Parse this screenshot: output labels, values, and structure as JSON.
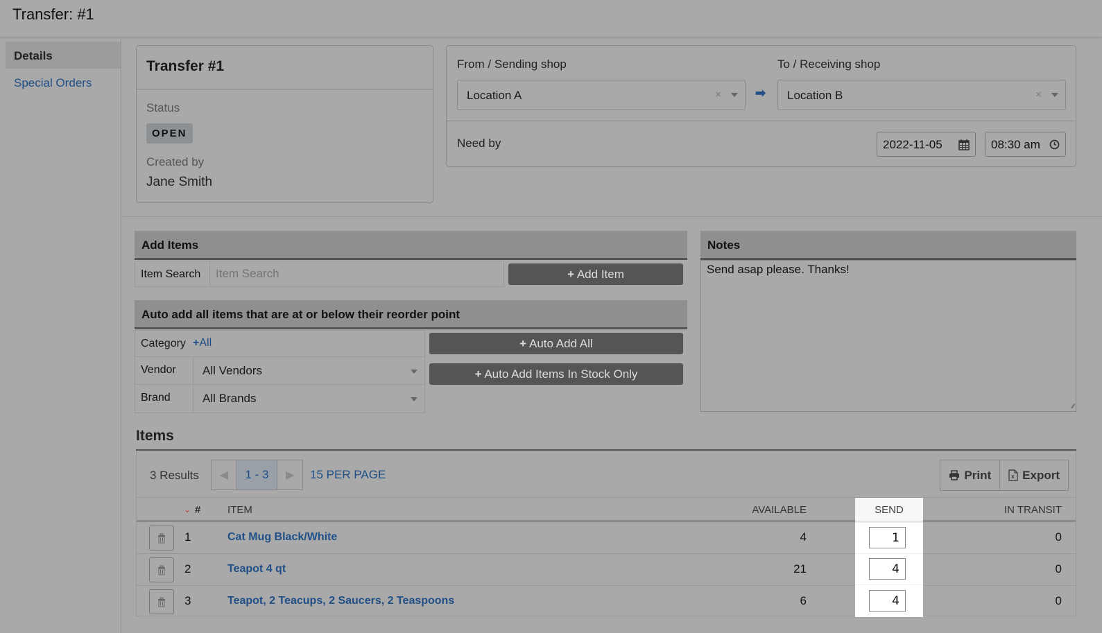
{
  "header": {
    "title": "Transfer: #1"
  },
  "sidebar": {
    "items": [
      {
        "label": "Details",
        "active": true
      },
      {
        "label": "Special Orders",
        "active": false
      }
    ]
  },
  "transfer_card": {
    "title": "Transfer #1",
    "status_label": "Status",
    "status_value": "OPEN",
    "created_by_label": "Created by",
    "created_by_value": "Jane Smith"
  },
  "shops": {
    "from_label": "From / Sending shop",
    "from_value": "Location A",
    "to_label": "To / Receiving shop",
    "to_value": "Location B",
    "clear_glyph": "×",
    "arrow_glyph": "➡",
    "need_by_label": "Need by",
    "need_by_date": "2022-11-05",
    "need_by_time": "08:30 am"
  },
  "add_items": {
    "title": "Add Items",
    "search_label": "Item Search",
    "search_placeholder": "Item Search",
    "add_button": "Add Item"
  },
  "auto_add": {
    "title": "Auto add all items that are at or below their reorder point",
    "category_label": "Category",
    "category_value": "All",
    "vendor_label": "Vendor",
    "vendor_value": "All Vendors",
    "brand_label": "Brand",
    "brand_value": "All Brands",
    "auto_add_all_button": "Auto Add All",
    "auto_add_stock_button": "Auto Add Items In Stock Only"
  },
  "notes": {
    "title": "Notes",
    "text": "Send asap please. Thanks!"
  },
  "items": {
    "title": "Items",
    "results": "3 Results",
    "page_range": "1 - 3",
    "per_page": "15 PER PAGE",
    "print_label": "Print",
    "export_label": "Export",
    "columns": {
      "num": "#",
      "item": "ITEM",
      "available": "AVAILABLE",
      "send": "SEND",
      "in_transit": "IN TRANSIT"
    },
    "rows": [
      {
        "num": "1",
        "item": "Cat Mug Black/White",
        "available": "4",
        "send": "1",
        "in_transit": "0"
      },
      {
        "num": "2",
        "item": "Teapot 4 qt",
        "available": "21",
        "send": "4",
        "in_transit": "0"
      },
      {
        "num": "3",
        "item": "Teapot, 2 Teacups, 2 Saucers, 2 Teaspoons",
        "available": "6",
        "send": "4",
        "in_transit": "0"
      }
    ]
  },
  "colors": {
    "link": "#1f4f86",
    "sort_indicator": "#c0392b",
    "button_dark": "#555555",
    "highlight": "#ffffff"
  }
}
